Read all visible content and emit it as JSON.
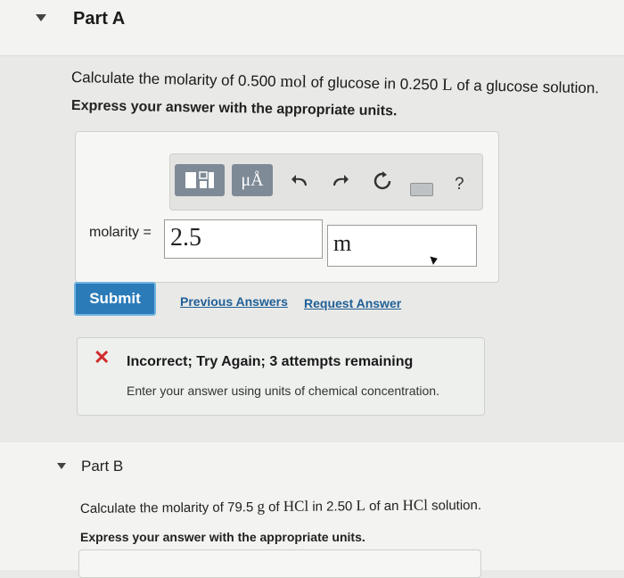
{
  "part_a": {
    "title": "Part A",
    "question": {
      "prefix": "Calculate the molarity of 0.500 ",
      "unit1": "mol",
      "middle": " of glucose in 0.250 ",
      "unit2": "L",
      "suffix": " of a glucose solution."
    },
    "instruction": "Express your answer with the appropriate units.",
    "toolbar": {
      "units_label": "μÅ",
      "buttons": [
        "templates-icon",
        "units-icon",
        "undo-icon",
        "redo-icon",
        "reset-icon",
        "keyboard-icon",
        "help-icon"
      ],
      "help_label": "?"
    },
    "answer": {
      "label": "molarity =",
      "value": "2.5",
      "unit": "m"
    },
    "submit_label": "Submit",
    "links": {
      "previous_answers": "Previous Answers",
      "request_answer": "Request Answer"
    },
    "feedback": {
      "title": "Incorrect; Try Again; 3 attempts remaining",
      "message": "Enter your answer using units of chemical concentration.",
      "status_color": "#d12b2b"
    }
  },
  "part_b": {
    "title": "Part B",
    "question": {
      "prefix": "Calculate the molarity of 79.5 ",
      "unit1": "g",
      "middle1": " of ",
      "chem1": "HCl",
      "middle2": " in 2.50 ",
      "unit2": "L",
      "middle3": " of an ",
      "chem2": "HCl",
      "suffix": " solution."
    },
    "instruction": "Express your answer with the appropriate units."
  },
  "colors": {
    "submit_bg": "#2b7bb9",
    "link": "#1f5f96",
    "toolbar_button": "#7e8a96"
  }
}
